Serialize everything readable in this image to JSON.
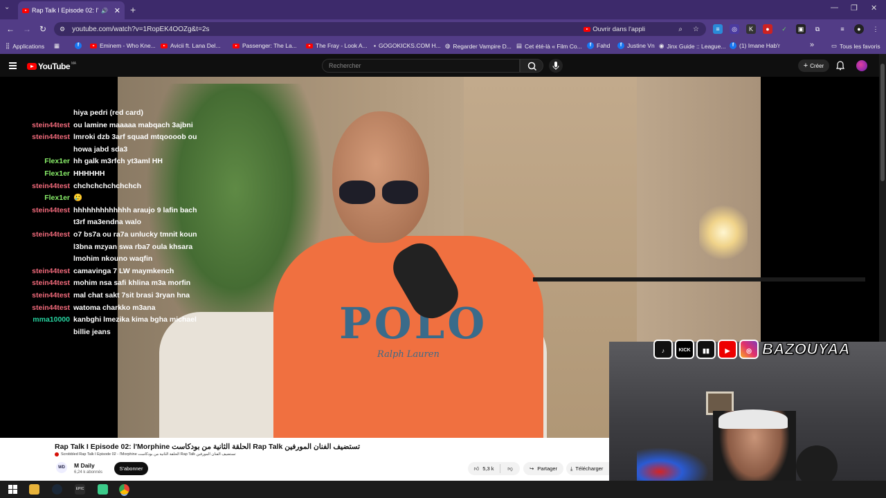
{
  "browser": {
    "tab_title": "Rap Talk I Episode 02: l'Morphine",
    "url": "youtube.com/watch?v=1RopEK4OOZg&t=2s",
    "open_in_app": "Ouvrir dans l'appli",
    "bookmarks": [
      {
        "label": "Applications",
        "icon": "apps-grid-icon"
      },
      {
        "label": "Eminem - Who Kne...",
        "icon": "youtube-icon"
      },
      {
        "label": "Avicii ft. Lana Del...",
        "icon": "youtube-icon"
      },
      {
        "label": "Passenger: The La...",
        "icon": "youtube-icon"
      },
      {
        "label": "The Fray - Look A...",
        "icon": "youtube-icon"
      },
      {
        "label": "GOGOKICKS.COM H...",
        "icon": "site-icon"
      },
      {
        "label": "Regarder Vampire D...",
        "icon": "globe-icon"
      },
      {
        "label": "Cet été-là « Film Co...",
        "icon": "site-icon"
      },
      {
        "label": "Fahd",
        "icon": "facebook-icon"
      },
      {
        "label": "Justine Vn",
        "icon": "facebook-icon"
      },
      {
        "label": "Jinx Guide :: League...",
        "icon": "site-icon"
      },
      {
        "label": "(1) Imane Hab'r",
        "icon": "facebook-icon"
      }
    ],
    "all_bookmarks": "Tous les favoris",
    "more_bookmarks": "»"
  },
  "youtube": {
    "logo_text": "YouTube",
    "region": "MA",
    "search_placeholder": "Rechercher",
    "create_label": "Créer"
  },
  "chat": [
    {
      "user": "",
      "message": "hiya pedri (red card)",
      "color": "red"
    },
    {
      "user": "stein44test",
      "message": "ou lamine maaaaa mabqach 3ajbni",
      "color": "red"
    },
    {
      "user": "stein44test",
      "message": "lmroki dzb 3arf squad mtqoooob ou howa jabd sda3",
      "color": "red"
    },
    {
      "user": "Flex1er",
      "message": "hh galk m3rfch yt3aml HH",
      "color": "green"
    },
    {
      "user": "Flex1er",
      "message": "HHHHHH",
      "color": "green"
    },
    {
      "user": "stein44test",
      "message": "chchchchchchchch",
      "color": "red"
    },
    {
      "user": "Flex1er",
      "message": "🥲",
      "color": "green"
    },
    {
      "user": "stein44test",
      "message": "hhhhhhhhhhhhh araujo 9 lafin bach t3rf ma3endna walo",
      "color": "red"
    },
    {
      "user": "stein44test",
      "message": "o7 bs7a ou ra7a unlucky tmnit koun l3bna mzyan swa rba7 oula khsara lmohim nkouno waqfin",
      "color": "red"
    },
    {
      "user": "stein44test",
      "message": "camavinga 7 LW maymkench",
      "color": "red"
    },
    {
      "user": "stein44test",
      "message": "mohim nsa safi khlina m3a morfin",
      "color": "red"
    },
    {
      "user": "stein44test",
      "message": "mal chat sakt 7sit brasi 3ryan hna",
      "color": "red"
    },
    {
      "user": "stein44test",
      "message": "watoma charkko m3ana",
      "color": "red"
    },
    {
      "user": "mma10000",
      "message": "kanbghi lmezika kima bgha michael billie jeans",
      "color": "teal"
    }
  ],
  "video": {
    "title": "Rap Talk I Episode 02: l'Morphine الحلقة الثانية من بودكاست Rap Talk تستضيف الفنان المورفين",
    "scrobbled": "Scrobbled Rap Talk I Episode 02 - l'Morphine الحلقة الثانية من بودكاست Rap Talk تستضيف الفنان المورفين",
    "channel": "M Daily",
    "subscribers": "6,24 k abonnés",
    "subscribe_label": "S'abonner",
    "likes": "5,3 k",
    "share_label": "Partager",
    "download_label": "Télécharger",
    "shirt_text": "POLO",
    "shirt_brand": "Ralph Lauren"
  },
  "overlay": {
    "handle": "BAZOUYAA",
    "platforms": [
      "tiktok",
      "KICK",
      "twitch",
      "youtube",
      "instagram"
    ]
  },
  "colors": {
    "chrome_frame": "#3d2a6b",
    "chrome_toolbar": "#523c86",
    "yt_bg": "#0f0f0f",
    "chat_red": "#f16a7b",
    "chat_green": "#8af06a",
    "chat_teal": "#27d3a0",
    "shirt": "#f07040"
  }
}
